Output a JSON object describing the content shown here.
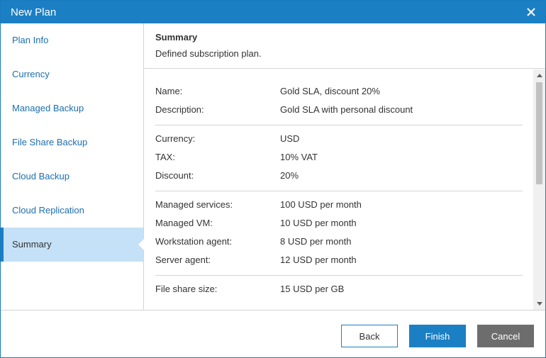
{
  "window": {
    "title": "New Plan"
  },
  "sidebar": {
    "items": [
      {
        "label": "Plan Info"
      },
      {
        "label": "Currency"
      },
      {
        "label": "Managed Backup"
      },
      {
        "label": "File Share Backup"
      },
      {
        "label": "Cloud Backup"
      },
      {
        "label": "Cloud Replication"
      },
      {
        "label": "Summary",
        "active": true
      }
    ]
  },
  "main": {
    "title": "Summary",
    "subtitle": "Defined subscription plan.",
    "groups": [
      [
        {
          "label": "Name:",
          "value": "Gold SLA, discount 20%"
        },
        {
          "label": "Description:",
          "value": "Gold SLA with personal discount"
        }
      ],
      [
        {
          "label": "Currency:",
          "value": "USD"
        },
        {
          "label": "TAX:",
          "value": "10% VAT"
        },
        {
          "label": "Discount:",
          "value": "20%"
        }
      ],
      [
        {
          "label": "Managed services:",
          "value": "100 USD per month"
        },
        {
          "label": "Managed VM:",
          "value": "10 USD per month"
        },
        {
          "label": "Workstation agent:",
          "value": "8 USD per month"
        },
        {
          "label": "Server agent:",
          "value": "12 USD per month"
        }
      ],
      [
        {
          "label": "File share size:",
          "value": "15 USD per GB"
        }
      ]
    ]
  },
  "footer": {
    "back_label": "Back",
    "finish_label": "Finish",
    "cancel_label": "Cancel"
  },
  "icons": {
    "close": "close-icon",
    "scroll_up": "scroll-up-arrow-icon",
    "scroll_down": "scroll-down-arrow-icon"
  },
  "colors": {
    "accent": "#1b7fc4",
    "active_nav": "#c4e1f7",
    "cancel": "#6d6d6d"
  }
}
